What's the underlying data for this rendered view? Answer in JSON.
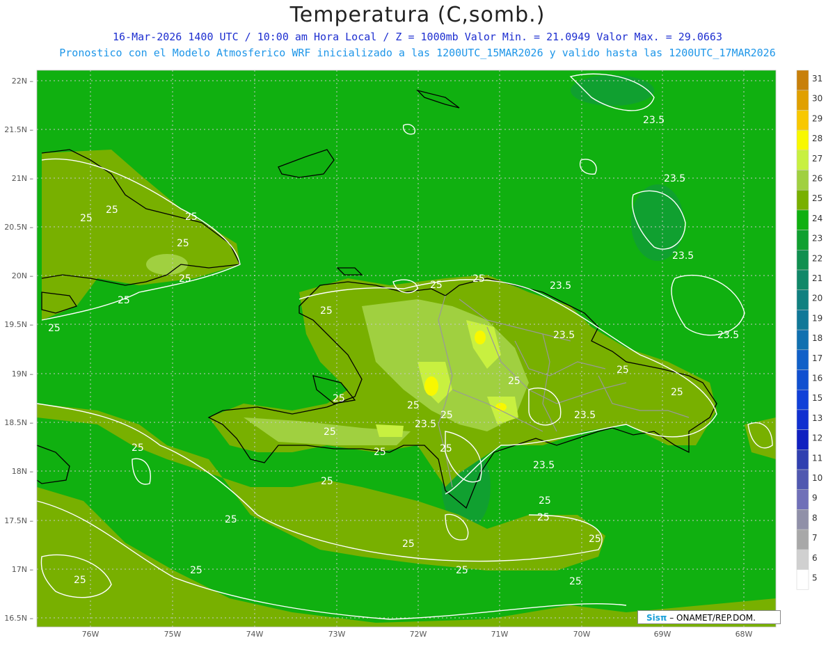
{
  "header": {
    "title": "Temperatura (C,somb.)",
    "line1": "16-Mar-2026 1400 UTC / 10:00 am Hora Local / Z = 1000mb  Valor Min. = 21.0949  Valor Max. = 29.0663",
    "line2": "Pronostico con el Modelo Atmosferico WRF inicializado a las 1200UTC_15MAR2026 y valido hasta las  1200UTC_17MAR2026"
  },
  "axes": {
    "lat_labels": [
      "22N",
      "21.5N",
      "21N",
      "20.5N",
      "20N",
      "19.5N",
      "19N",
      "18.5N",
      "18N",
      "17.5N",
      "17N",
      "16.5N"
    ],
    "lon_labels": [
      "76W",
      "75W",
      "74W",
      "73W",
      "72W",
      "71W",
      "70W",
      "69W",
      "68W"
    ]
  },
  "colorbar": {
    "levels": [
      "31",
      "30",
      "29",
      "28",
      "27",
      "26",
      "25",
      "24",
      "23",
      "22",
      "21",
      "20",
      "19",
      "18",
      "17",
      "16",
      "15",
      "13",
      "12",
      "11",
      "10",
      "9",
      "8",
      "7",
      "6",
      "5"
    ],
    "colors": [
      "#c8800a",
      "#e0a000",
      "#f8c800",
      "#f8f800",
      "#c8f040",
      "#a0d040",
      "#78b000",
      "#10b010",
      "#10a030",
      "#109050",
      "#108868",
      "#108080",
      "#107898",
      "#1070b0",
      "#1060c8",
      "#1050d0",
      "#1040d8",
      "#1030d0",
      "#1020c0",
      "#3040b0",
      "#5058b0",
      "#7070b8",
      "#9090a8",
      "#a8a8a8",
      "#d0d0d0",
      "#ffffff"
    ]
  },
  "contour_labels": [
    "25",
    "25",
    "25",
    "25",
    "25",
    "25",
    "25",
    "25",
    "25",
    "25",
    "25",
    "25",
    "25",
    "25",
    "25",
    "25",
    "25",
    "25",
    "25",
    "25",
    "25",
    "25",
    "25",
    "25",
    "25",
    "23.5",
    "23.5",
    "23.5",
    "23.5",
    "23.5",
    "23.5",
    "23.5",
    "23.5"
  ],
  "credit": {
    "logo": "Sisπ",
    "text": "– ONAMET/REP.DOM."
  },
  "colors": {
    "ocean": "#10b010",
    "land_warm": "#78b000",
    "land_hot": "#c8f040",
    "contour": "#ffffff",
    "border": "#999999",
    "coast": "#000000"
  }
}
